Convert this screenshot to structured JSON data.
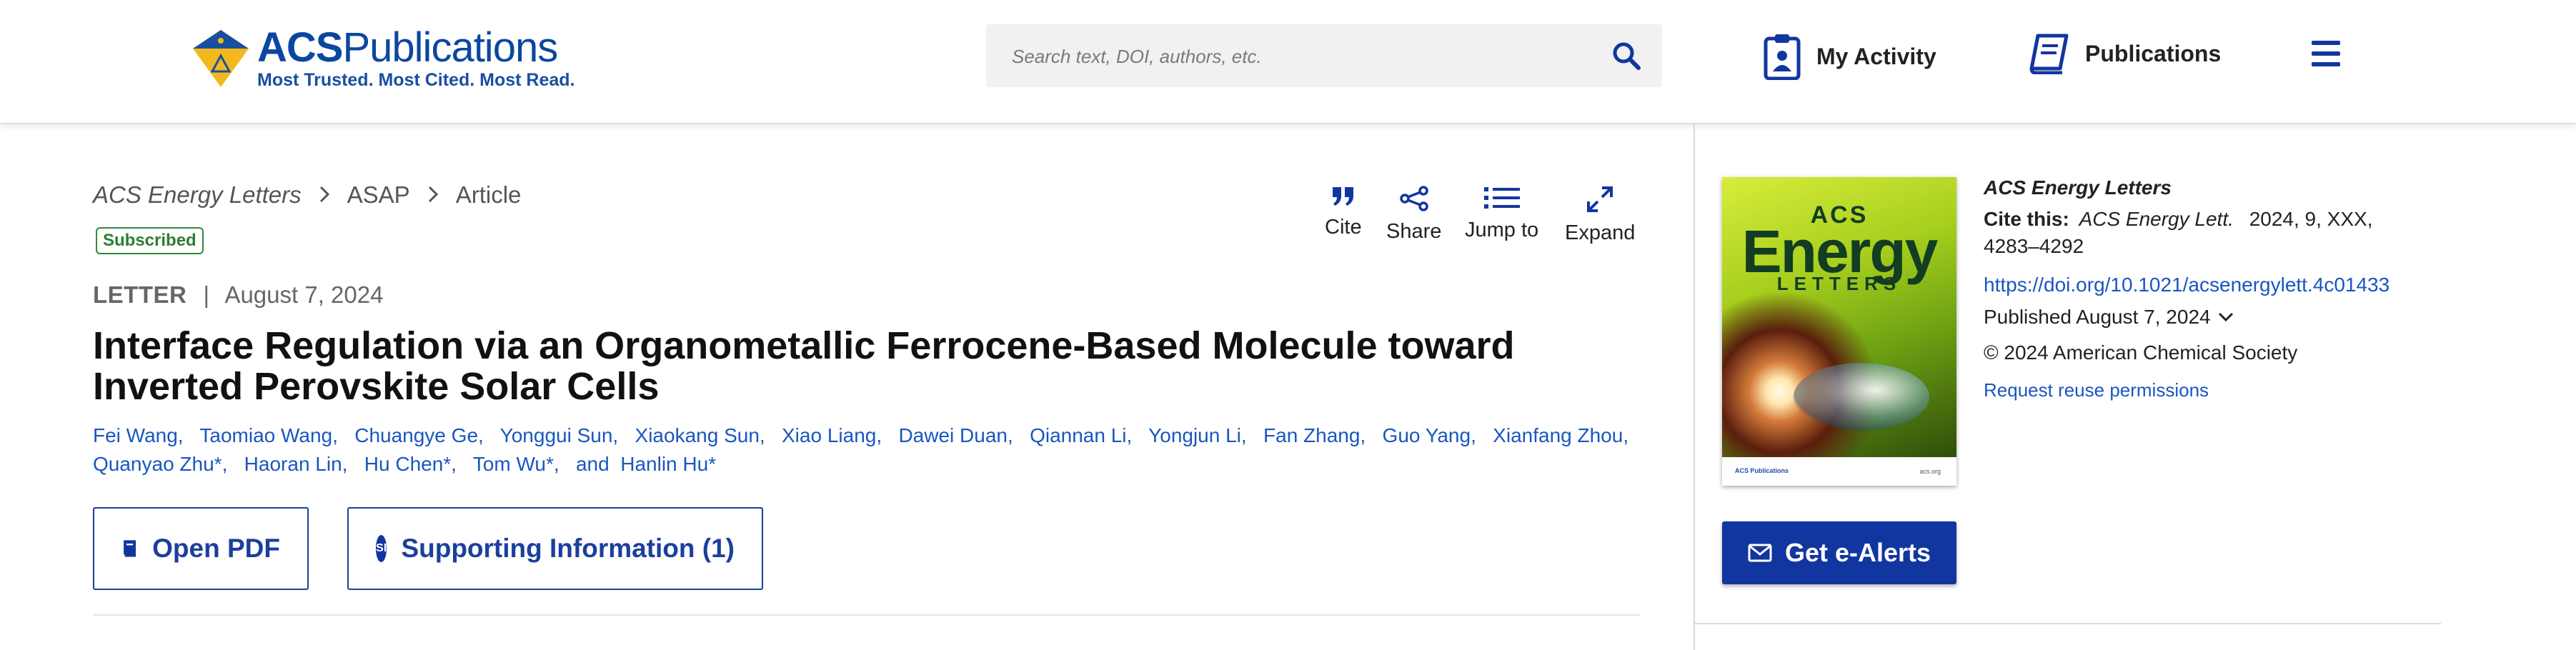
{
  "header": {
    "logo_brand_bold": "ACS",
    "logo_brand": "Publications",
    "logo_tagline": "Most Trusted. Most Cited. Most Read.",
    "search_placeholder": "Search text, DOI, authors, etc.",
    "my_activity": "My Activity",
    "publications": "Publications"
  },
  "breadcrumb": {
    "journal": "ACS Energy Letters",
    "section": "ASAP",
    "page": "Article"
  },
  "badge": "Subscribed",
  "tools": {
    "cite": "Cite",
    "share": "Share",
    "jump": "Jump to",
    "expand": "Expand"
  },
  "article": {
    "type": "LETTER",
    "separator": "|",
    "date": "August 7, 2024",
    "title": "Interface Regulation via an Organometallic Ferrocene-Based Molecule toward Inverted Perovskite Solar Cells",
    "authors_line1": "Fei Wang,   Taomiao Wang,   Chuangye Ge,   Yonggui Sun,   Xiaokang Sun,   Xiao Liang,   Dawei Duan,   Qiannan Li,   Yongjun Li,   Fan Zhang,   Guo Yang,   Xianfang Zhou,",
    "authors_line2": "Quanyao Zhu*,   Haoran Lin,   Hu Chen*,   Tom Wu*,   and  Hanlin Hu*"
  },
  "buttons": {
    "open_pdf": "Open PDF",
    "si_badge": "SI",
    "supporting_info": "Supporting Information (1)",
    "alerts": "Get e-Alerts"
  },
  "cover": {
    "acs": "ACS",
    "energy": "Energy",
    "letters": "LETTERS",
    "foot_left": "ACS Publications",
    "foot_right": "acs.org"
  },
  "info": {
    "journal": "ACS Energy Letters",
    "cite_label": "Cite this:",
    "cite_journal": "ACS Energy Lett.",
    "cite_detail": "2024, 9, XXX, 4283–4292",
    "doi": "https://doi.org/10.1021/acsenergylett.4c01433",
    "published": "Published August 7, 2024",
    "copyright": "© 2024 American Chemical Society",
    "reuse": "Request reuse permissions"
  },
  "colors": {
    "brand_blue": "#1236a0",
    "link_blue": "#1a56c0",
    "badge_green": "#2e7d32"
  }
}
